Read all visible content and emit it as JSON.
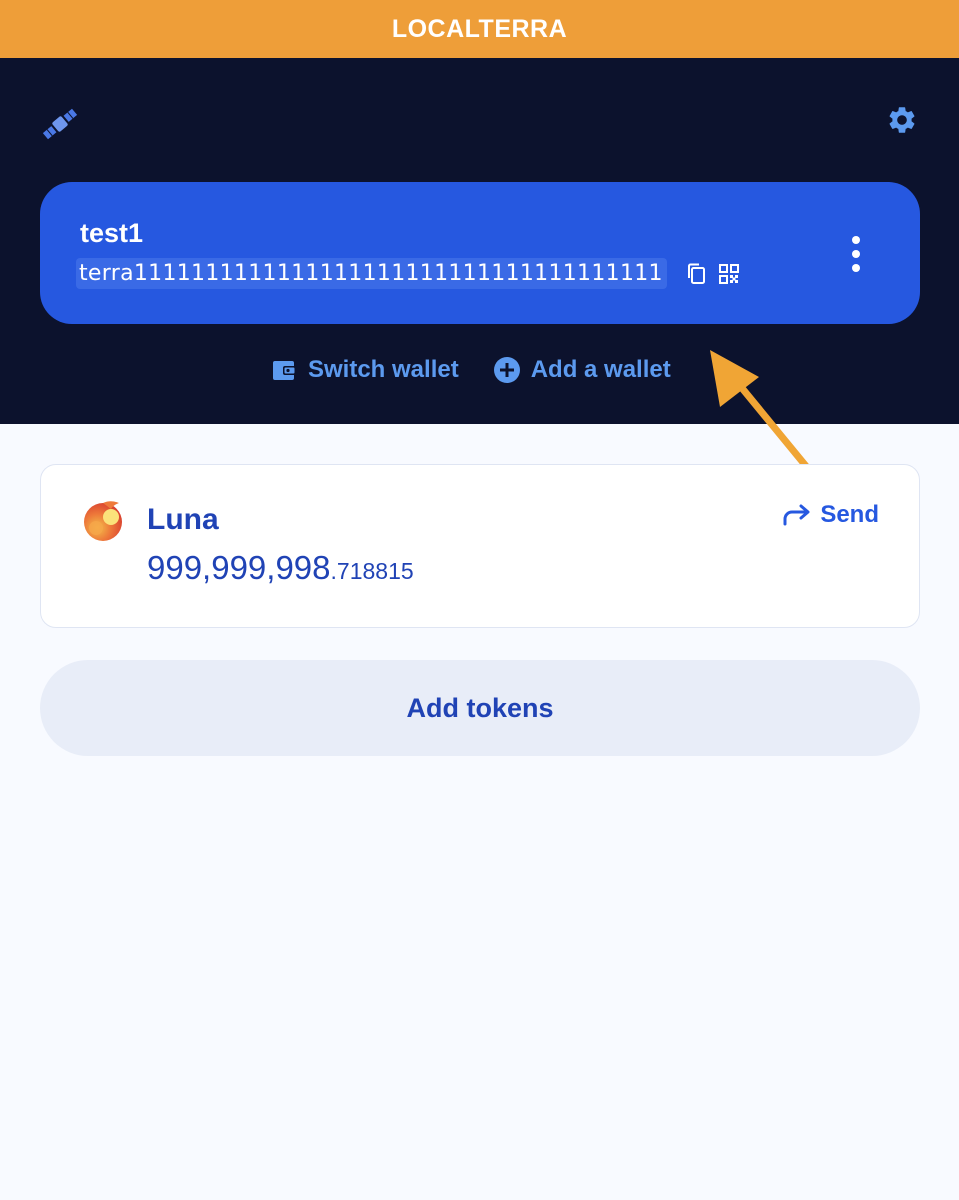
{
  "network": {
    "label": "LOCALTERRA"
  },
  "header": {
    "logo_icon": "satellite-icon",
    "settings_icon": "gear-icon"
  },
  "wallet": {
    "name": "test1",
    "address": "terra1111111111111111111111111111111111111",
    "copy_icon": "copy-icon",
    "qr_icon": "qr-code-icon",
    "more_icon": "more-vertical-icon",
    "actions": {
      "switch_label": "Switch wallet",
      "add_label": "Add a wallet"
    }
  },
  "token": {
    "name": "Luna",
    "balance_integer": "999,999,998",
    "balance_decimal": ".718815",
    "send_label": "Send"
  },
  "add_tokens_label": "Add tokens",
  "colors": {
    "network_bar": "#ee9e39",
    "header_bg": "#0c122d",
    "card_blue": "#2658e0",
    "text_blue": "#2043b5",
    "annotation_arrow": "#f0a535"
  }
}
